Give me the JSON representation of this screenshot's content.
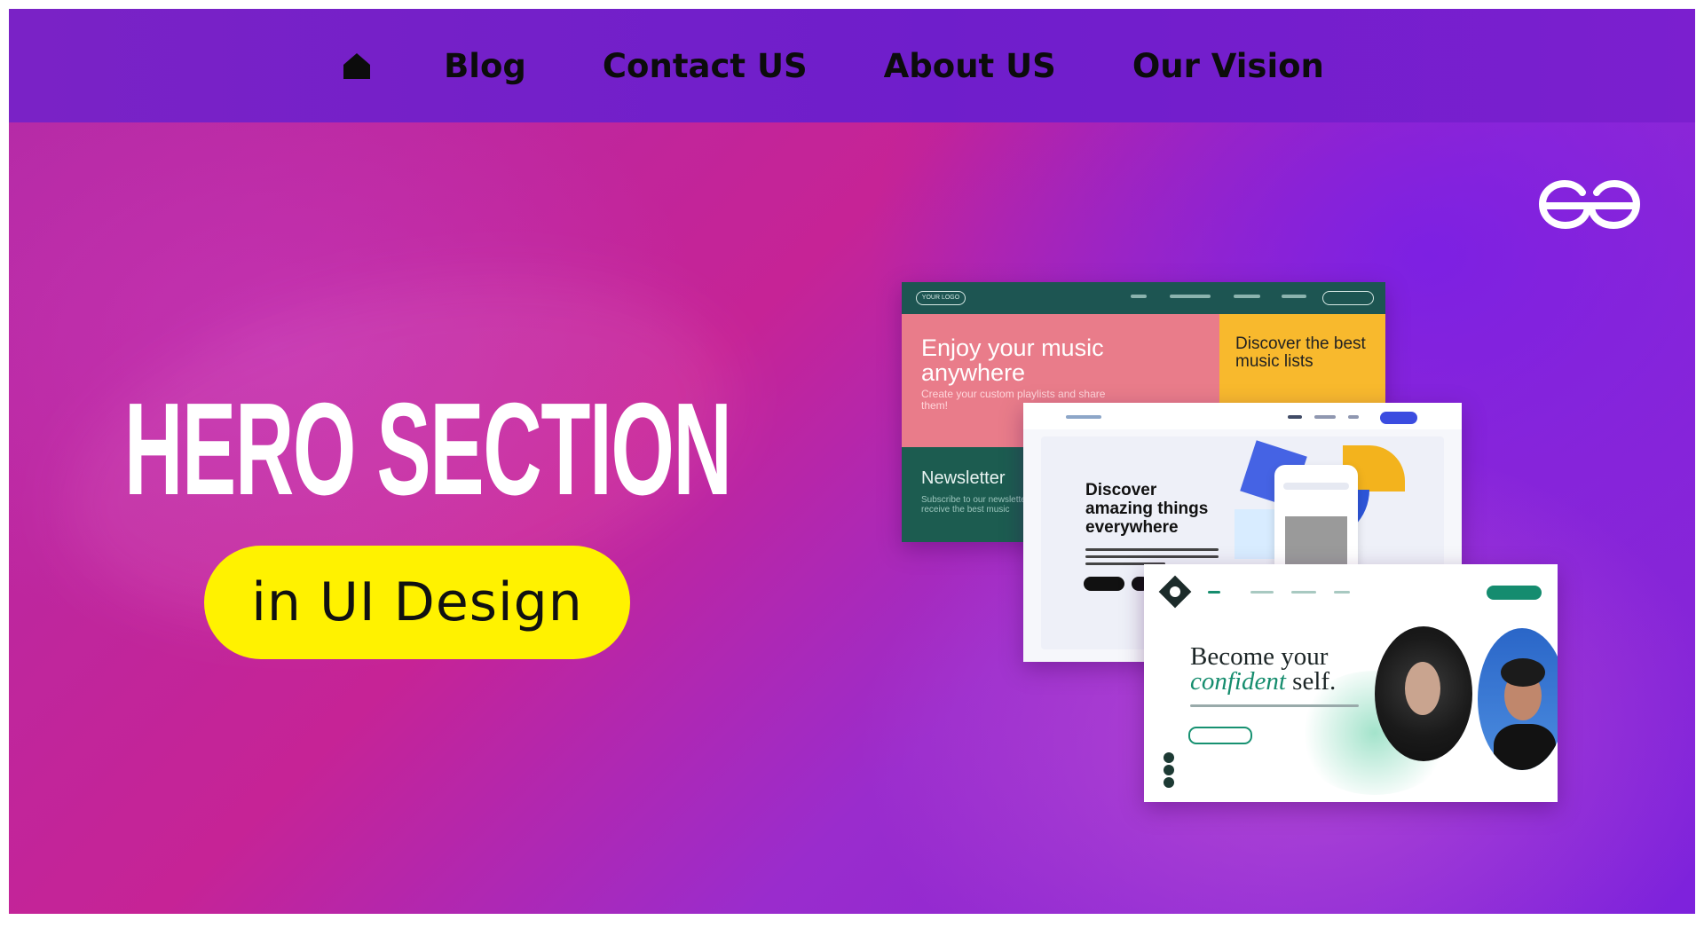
{
  "nav": {
    "home_icon": "home-icon",
    "items": [
      {
        "label": "Blog"
      },
      {
        "label": "Contact US"
      },
      {
        "label": "About US"
      },
      {
        "label": "Our Vision"
      }
    ]
  },
  "hero": {
    "title": "HERO SECTION",
    "subtitle": "in UI Design",
    "logo": "gfg-logo",
    "mockups": {
      "card1": {
        "logo": "YOUR LOGO",
        "headline": "Enjoy your music anywhere",
        "sub": "Create your custom playlists and share them!",
        "side": "Discover the best music lists",
        "newsletter": "Newsletter",
        "newsletter_sub": "Subscribe to our newsletter to receive the best music"
      },
      "card2": {
        "headline": "Discover amazing things everywhere"
      },
      "card3": {
        "headline_line1": "Become your",
        "headline_em": "confident",
        "headline_rest": " self."
      }
    }
  },
  "colors": {
    "nav_bg": "#7a22c6",
    "pill": "#fff200",
    "hero_pink": "#c62396",
    "hero_purple": "#7d22dc"
  }
}
